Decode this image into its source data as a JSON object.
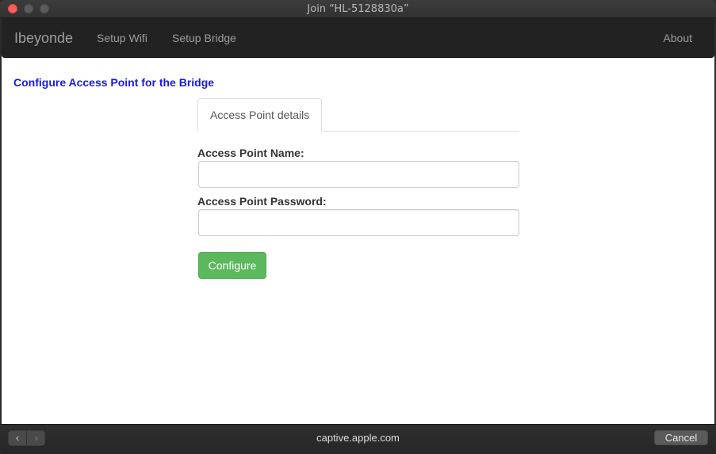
{
  "window": {
    "title": "Join “HL-5128830a”"
  },
  "navbar": {
    "brand": "Ibeyonde",
    "links": [
      "Setup Wifi",
      "Setup Bridge"
    ],
    "right_link": "About"
  },
  "main": {
    "heading": "Configure Access Point for the Bridge",
    "tabs": [
      {
        "label": "Access Point details",
        "active": true
      }
    ],
    "form": {
      "name_label": "Access Point Name:",
      "name_value": "",
      "password_label": "Access Point Password:",
      "password_value": "",
      "submit_label": "Configure"
    }
  },
  "toolbar": {
    "back_icon": "chevron-left-icon",
    "forward_icon": "chevron-right-icon",
    "url": "captive.apple.com",
    "cancel_label": "Cancel"
  },
  "colors": {
    "heading": "#1a1adb",
    "navbar_bg": "#222222",
    "success_button": "#5cb85c"
  }
}
